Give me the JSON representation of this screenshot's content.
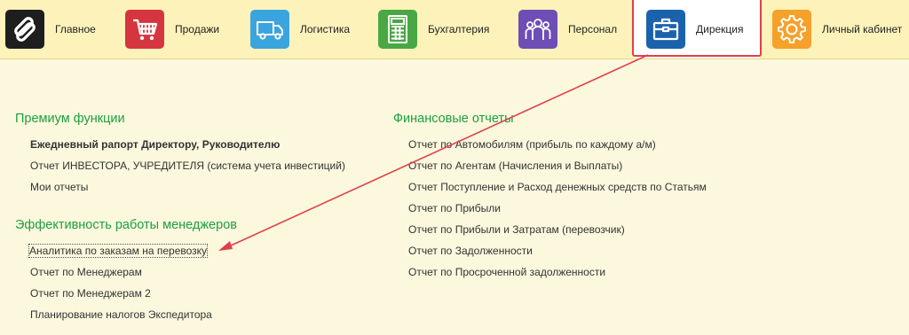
{
  "nav": {
    "tabs": [
      {
        "label": "Главное",
        "icon": "logo-icon",
        "color": "#1e1e1e"
      },
      {
        "label": "Продажи",
        "icon": "shopping-cart-icon",
        "color": "#d5353e"
      },
      {
        "label": "Логистика",
        "icon": "truck-icon",
        "color": "#3aa4df"
      },
      {
        "label": "Бухгалтерия",
        "icon": "calculator-icon",
        "color": "#4aa844"
      },
      {
        "label": "Персонал",
        "icon": "people-icon",
        "color": "#6e4db5"
      },
      {
        "label": "Дирекция",
        "icon": "briefcase-icon",
        "color": "#1b62ad"
      },
      {
        "label": "Личный кабинет",
        "icon": "gear-icon",
        "color": "#f5a12a"
      }
    ],
    "active_tab": "Дирекция"
  },
  "sections": {
    "premium": {
      "title": "Премиум функции",
      "items": [
        "Ежедневный рапорт Директору, Руководителю",
        "Отчет ИНВЕСТОРА, УЧРЕДИТЕЛЯ (система учета инвестиций)",
        "Мои отчеты"
      ]
    },
    "managers": {
      "title": "Эффективность работы менеджеров",
      "items": [
        "Аналитика по заказам на перевозку",
        "Отчет по Менеджерам",
        "Отчет по Менеджерам 2",
        "Планирование налогов Экспедитора"
      ]
    },
    "finance": {
      "title": "Финансовые отчеты",
      "items": [
        "Отчет по Автомобилям (прибыль по каждому а/м)",
        "Отчет по Агентам (Начисления и Выплаты)",
        "Отчет Поступление и Расход денежных средств по Статьям",
        "Отчет по Прибыли",
        "Отчет по Прибыли и Затратам (перевозчик)",
        "Отчет по Задолженности",
        "Отчет по Просроченной задолженности"
      ]
    }
  },
  "annotation": {
    "color": "#e0404a"
  }
}
